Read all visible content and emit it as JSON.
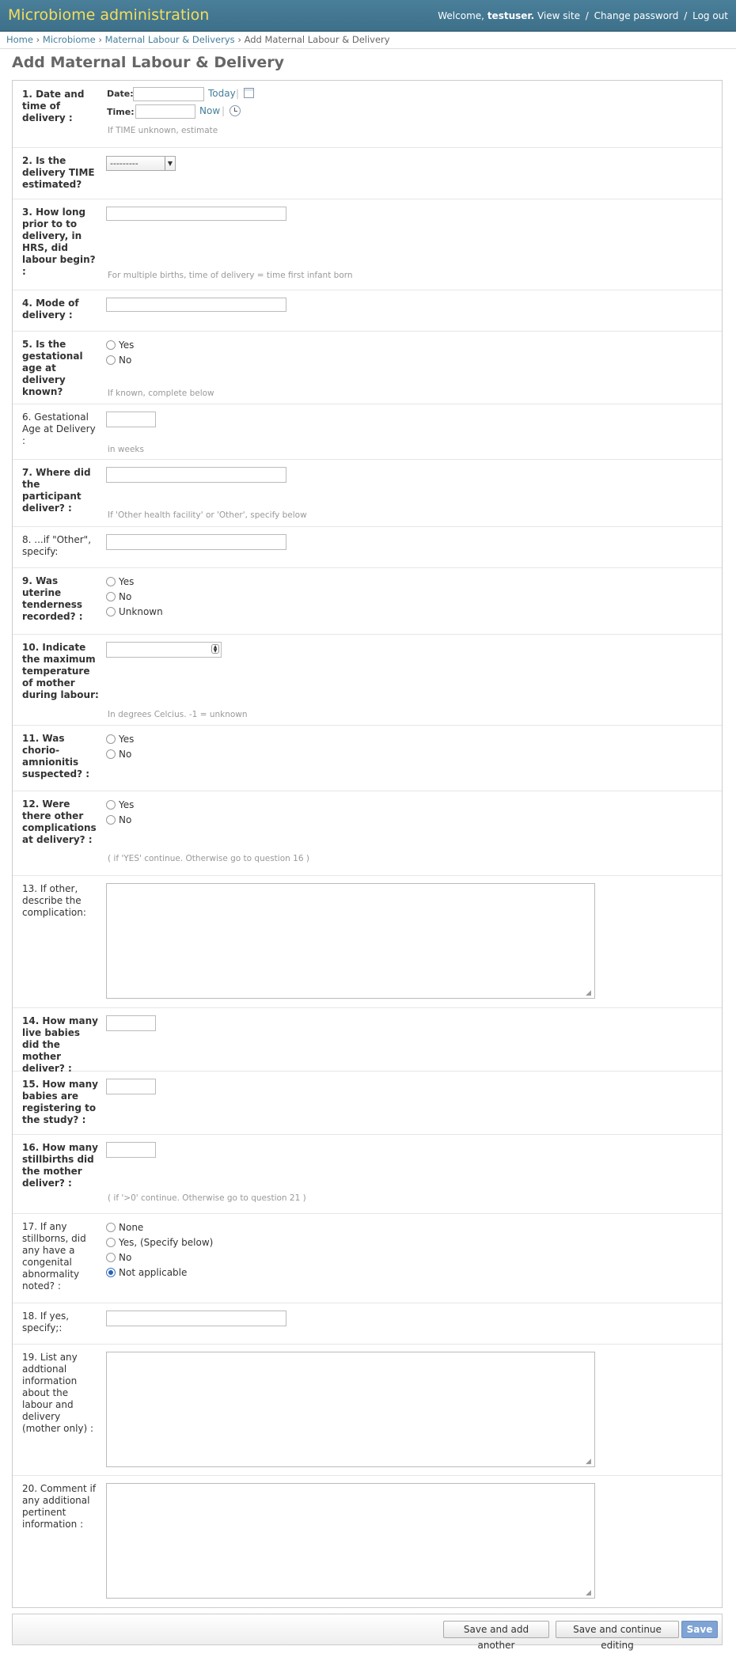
{
  "header": {
    "brand": "Microbiome administration",
    "welcome": "Welcome,",
    "username": "testuser.",
    "view_site": "View site",
    "change_password": "Change password",
    "log_out": "Log out",
    "separator": "/"
  },
  "breadcrumbs": {
    "home": "Home",
    "app": "Microbiome",
    "model": "Maternal Labour & Deliverys",
    "current": "Add Maternal Labour & Delivery",
    "separator": "›"
  },
  "page_title": "Add Maternal Labour & Delivery",
  "q1": {
    "label": "1. Date and time of delivery :",
    "date_label": "Date:",
    "time_label": "Time:",
    "today": "Today",
    "now": "Now",
    "pipe": "|",
    "help": "If TIME unknown, estimate"
  },
  "q2": {
    "label": "2. Is the delivery TIME estimated?",
    "selected": "---------"
  },
  "q3": {
    "label": "3. How long prior to to delivery, in HRS, did labour begin? :",
    "help": "For multiple births, time of delivery = time first infant born"
  },
  "q4": {
    "label": "4. Mode of delivery :"
  },
  "q5": {
    "label": "5. Is the gestational age at delivery known?",
    "options": [
      "Yes",
      "No"
    ],
    "help": "If known, complete below"
  },
  "q6": {
    "label": "6. Gestational Age at Delivery :",
    "help": "in weeks"
  },
  "q7": {
    "label": "7. Where did the participant deliver? :",
    "help": "If 'Other health facility' or 'Other', specify below"
  },
  "q8": {
    "label": "8. ...if \"Other\", specify:"
  },
  "q9": {
    "label": "9. Was uterine tenderness recorded? :",
    "options": [
      "Yes",
      "No",
      "Unknown"
    ]
  },
  "q10": {
    "label": "10. Indicate the maximum temperature of mother during labour:",
    "help": "In degrees Celcius. -1 = unknown"
  },
  "q11": {
    "label": "11. Was chorio-amnionitis suspected? :",
    "options": [
      "Yes",
      "No"
    ]
  },
  "q12": {
    "label": "12. Were there other complications at delivery? :",
    "options": [
      "Yes",
      "No"
    ],
    "help": "( if 'YES' continue. Otherwise go to question 16 )"
  },
  "q13": {
    "label": "13. If other, describe the complication:"
  },
  "q14": {
    "label": "14. How many live babies did the mother deliver? :"
  },
  "q15": {
    "label": "15. How many babies are registering to the study? :"
  },
  "q16": {
    "label": "16. How many stillbirths did the mother deliver? :",
    "help": "( if '>0' continue. Otherwise go to question 21 )"
  },
  "q17": {
    "label": "17. If any stillborns, did any have a congenital abnormality noted? :",
    "options": [
      "None",
      "Yes, (Specify below)",
      "No",
      "Not applicable"
    ],
    "selected": "Not applicable"
  },
  "q18": {
    "label": "18. If yes, specify;:"
  },
  "q19": {
    "label": "19. List any addtional information about the labour and delivery (mother only) :"
  },
  "q20": {
    "label": "20. Comment if any additional pertinent information :"
  },
  "buttons": {
    "save_add_another": "Save and add another",
    "save_continue": "Save and continue editing",
    "save": "Save"
  }
}
